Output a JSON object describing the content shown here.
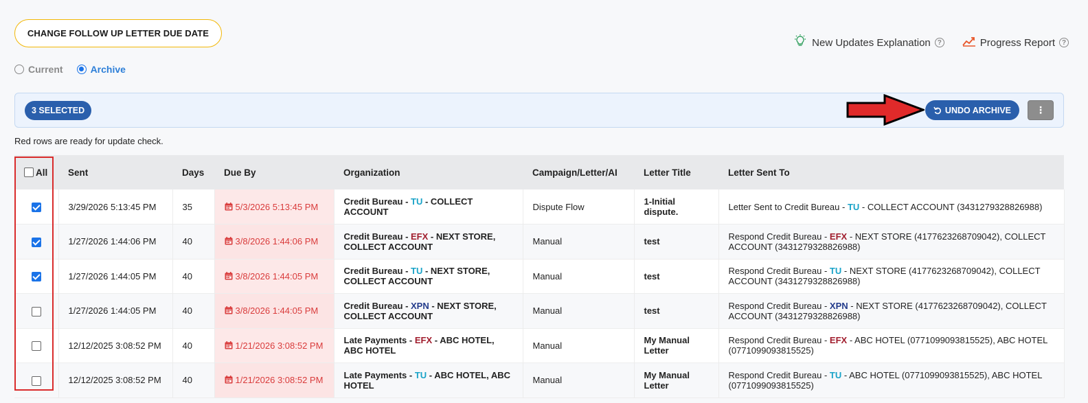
{
  "header": {
    "change_button": "CHANGE FOLLOW UP LETTER DUE DATE",
    "updates_link": "New Updates Explanation",
    "progress_link": "Progress Report",
    "help_glyph": "?"
  },
  "view_toggle": {
    "current": "Current",
    "archive": "Archive",
    "selected": "archive"
  },
  "selection_bar": {
    "selected_label": "3 SELECTED",
    "undo_label": "UNDO ARCHIVE",
    "more_glyph": "⋮"
  },
  "note": "Red rows are ready for update check.",
  "table": {
    "columns": [
      "All",
      "Sent",
      "Days",
      "Due By",
      "Organization",
      "Campaign/Letter/AI",
      "Letter Title",
      "Letter Sent To"
    ],
    "rows": [
      {
        "checked": true,
        "sent": "3/29/2026 5:13:45 PM",
        "days": "35",
        "due": "5/3/2026 5:13:45 PM",
        "org_prefix": "Credit Bureau - ",
        "org_bureau": "TU",
        "org_suffix": " - COLLECT ACCOUNT",
        "campaign": "Dispute Flow",
        "title": "1-Initial dispute.",
        "to_prefix": "Letter Sent to Credit Bureau - ",
        "to_bureau": "TU",
        "to_suffix": " - COLLECT ACCOUNT (3431279328826988)"
      },
      {
        "checked": true,
        "sent": "1/27/2026 1:44:06 PM",
        "days": "40",
        "due": "3/8/2026 1:44:06 PM",
        "org_prefix": "Credit Bureau - ",
        "org_bureau": "EFX",
        "org_suffix": " - NEXT STORE, COLLECT ACCOUNT",
        "campaign": "Manual",
        "title": "test",
        "to_prefix": "Respond Credit Bureau - ",
        "to_bureau": "EFX",
        "to_suffix": " - NEXT STORE (4177623268709042), COLLECT ACCOUNT (3431279328826988)"
      },
      {
        "checked": true,
        "sent": "1/27/2026 1:44:05 PM",
        "days": "40",
        "due": "3/8/2026 1:44:05 PM",
        "org_prefix": "Credit Bureau - ",
        "org_bureau": "TU",
        "org_suffix": " - NEXT STORE, COLLECT ACCOUNT",
        "campaign": "Manual",
        "title": "test",
        "to_prefix": "Respond Credit Bureau - ",
        "to_bureau": "TU",
        "to_suffix": " - NEXT STORE (4177623268709042), COLLECT ACCOUNT (3431279328826988)"
      },
      {
        "checked": false,
        "sent": "1/27/2026 1:44:05 PM",
        "days": "40",
        "due": "3/8/2026 1:44:05 PM",
        "org_prefix": "Credit Bureau - ",
        "org_bureau": "XPN",
        "org_suffix": " - NEXT STORE, COLLECT ACCOUNT",
        "campaign": "Manual",
        "title": "test",
        "to_prefix": "Respond Credit Bureau - ",
        "to_bureau": "XPN",
        "to_suffix": " - NEXT STORE (4177623268709042), COLLECT ACCOUNT (3431279328826988)"
      },
      {
        "checked": false,
        "sent": "12/12/2025 3:08:52 PM",
        "days": "40",
        "due": "1/21/2026 3:08:52 PM",
        "org_prefix": "Late Payments - ",
        "org_bureau": "EFX",
        "org_suffix": " - ABC HOTEL, ABC HOTEL",
        "campaign": "Manual",
        "title": "My Manual Letter",
        "to_prefix": "Respond Credit Bureau - ",
        "to_bureau": "EFX",
        "to_suffix": " - ABC HOTEL (0771099093815525), ABC HOTEL (0771099093815525)"
      },
      {
        "checked": false,
        "sent": "12/12/2025 3:08:52 PM",
        "days": "40",
        "due": "1/21/2026 3:08:52 PM",
        "org_prefix": "Late Payments - ",
        "org_bureau": "TU",
        "org_suffix": " - ABC HOTEL, ABC HOTEL",
        "campaign": "Manual",
        "title": "My Manual Letter",
        "to_prefix": "Respond Credit Bureau - ",
        "to_bureau": "TU",
        "to_suffix": " - ABC HOTEL (0771099093815525), ABC HOTEL (0771099093815525)"
      }
    ]
  },
  "colors": {
    "accent_blue": "#2a5fac",
    "due_red": "#d93b3b",
    "tu": "#1aa3c8",
    "efx": "#a01c2c",
    "xpn": "#243c8c",
    "highlight_outline": "#d92b2b"
  }
}
